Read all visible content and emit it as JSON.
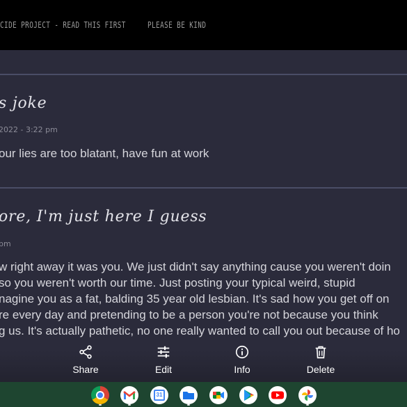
{
  "top_nav": {
    "links": [
      "ICIDE PROJECT - READ THIS FIRST",
      "PLEASE BE KIND"
    ]
  },
  "posts": [
    {
      "title": "s joke",
      "meta": "2022 - 3:22 pm",
      "body_lines": [
        "our lies are too blatant, have fun at work"
      ]
    },
    {
      "title": "ore, I'm just here I guess",
      "meta": "pm",
      "body_lines": [
        "w right away it was you. We just didn't say anything cause you weren't doin",
        "so you weren't worth our time. Just posting your typical weird, stupid",
        "nagine you as a fat, balding 35 year old lesbian. It's sad how you get off on",
        "re every day and pretending to be a person you're not because you think",
        "g us. It's actually pathetic, no one really wanted to call you out because of ho"
      ]
    }
  ],
  "action_bar": {
    "share": "Share",
    "edit": "Edit",
    "info": "Info",
    "delete": "Delete"
  },
  "shelf": {
    "color": "#1e4530",
    "apps": [
      {
        "name": "chrome-icon",
        "active": true
      },
      {
        "name": "gmail-icon",
        "active": true
      },
      {
        "name": "calendar-icon",
        "active": false,
        "day": "31"
      },
      {
        "name": "files-icon",
        "active": true
      },
      {
        "name": "meet-icon",
        "active": false
      },
      {
        "name": "play-store-icon",
        "active": false
      },
      {
        "name": "youtube-icon",
        "active": false
      },
      {
        "name": "photos-icon",
        "active": true
      }
    ]
  }
}
